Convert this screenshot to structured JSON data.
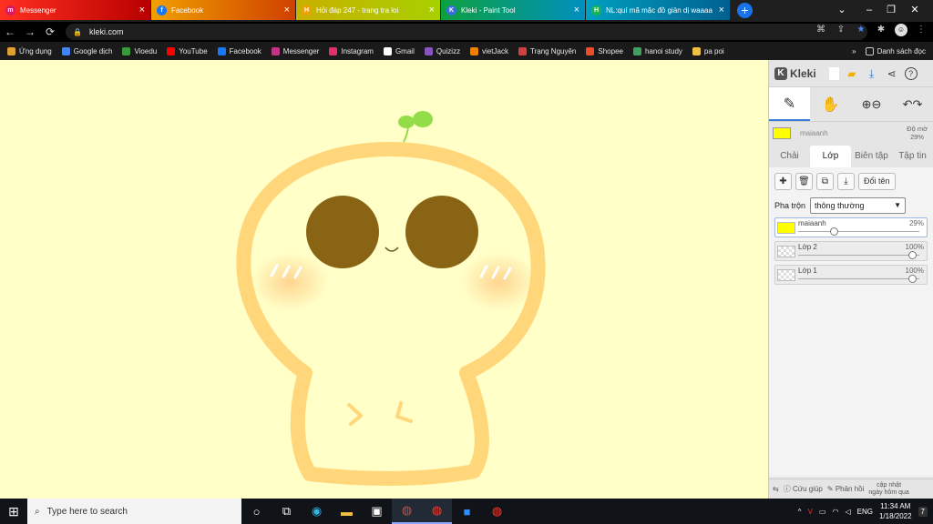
{
  "browser": {
    "tabs": [
      {
        "title": "Messenger",
        "color": "#d81b60"
      },
      {
        "title": "Facebook",
        "color": "#1877f2"
      },
      {
        "title": "Hỏi đáp 247 - trang tra loi",
        "color": "#f0a000"
      },
      {
        "title": "Kleki - Paint Tool",
        "color": "#3b6fd9"
      },
      {
        "title": "NL:quí mã mặc đồ giản dị waaaa",
        "color": "#19b34f"
      }
    ],
    "new_tab": "+",
    "url": "kleki.com"
  },
  "bookmarks": [
    {
      "label": "Ứng dụng",
      "color": "#e0a030"
    },
    {
      "label": "Google dịch",
      "color": "#4285f4"
    },
    {
      "label": "Vioedu",
      "color": "#3a9a3a"
    },
    {
      "label": "YouTube",
      "color": "#ff0000"
    },
    {
      "label": "Facebook",
      "color": "#1877f2"
    },
    {
      "label": "Messenger",
      "color": "#c13584"
    },
    {
      "label": "Instagram",
      "color": "#e1306c"
    },
    {
      "label": "Gmail",
      "color": "#ffffff"
    },
    {
      "label": "Quizizz",
      "color": "#8854c0"
    },
    {
      "label": "vietJack",
      "color": "#f08000"
    },
    {
      "label": "Trạng Nguyên",
      "color": "#d04040"
    },
    {
      "label": "Shopee",
      "color": "#ee4d2d"
    },
    {
      "label": "hanoi study",
      "color": "#40a060"
    },
    {
      "label": "pa poi",
      "color": "#f0c040"
    }
  ],
  "bookmarks_more": "»",
  "reading_list": "Danh sách đọc",
  "kleki": {
    "logo": "Kleki",
    "color_name": "maiaanh",
    "opacity_label": "Độ mờ",
    "opacity_value": "29%",
    "tabs": [
      "Chải",
      "Lớp",
      "Biên tập",
      "Tập tin"
    ],
    "active_tab": "Lớp",
    "rename_button": "Đổi tên",
    "blend_label": "Pha trộn",
    "blend_value": "thông thường",
    "layers": [
      {
        "name": "maiaanh",
        "opacity": "29%",
        "opacity_frac": 0.29,
        "active": true
      },
      {
        "name": "Lớp 2",
        "opacity": "100%",
        "opacity_frac": 1.0,
        "active": false
      },
      {
        "name": "Lớp 1",
        "opacity": "100%",
        "opacity_frac": 1.0,
        "active": false
      }
    ],
    "footer": {
      "help": "Cứu giúp",
      "feedback": "Phản hồi",
      "update_line1": "cập nhật",
      "update_line2": "ngày hôm qua"
    }
  },
  "taskbar": {
    "search_placeholder": "Type here to search",
    "language": "ENG",
    "time": "11:34 AM",
    "date": "1/18/2022",
    "notifications": "7"
  },
  "colors": {
    "canvas_bg": "#ffffc7",
    "outline": "#ffd67a",
    "eyes": "#8a6415",
    "sprout": "#93dd49",
    "primary_color": "#ffff00"
  }
}
